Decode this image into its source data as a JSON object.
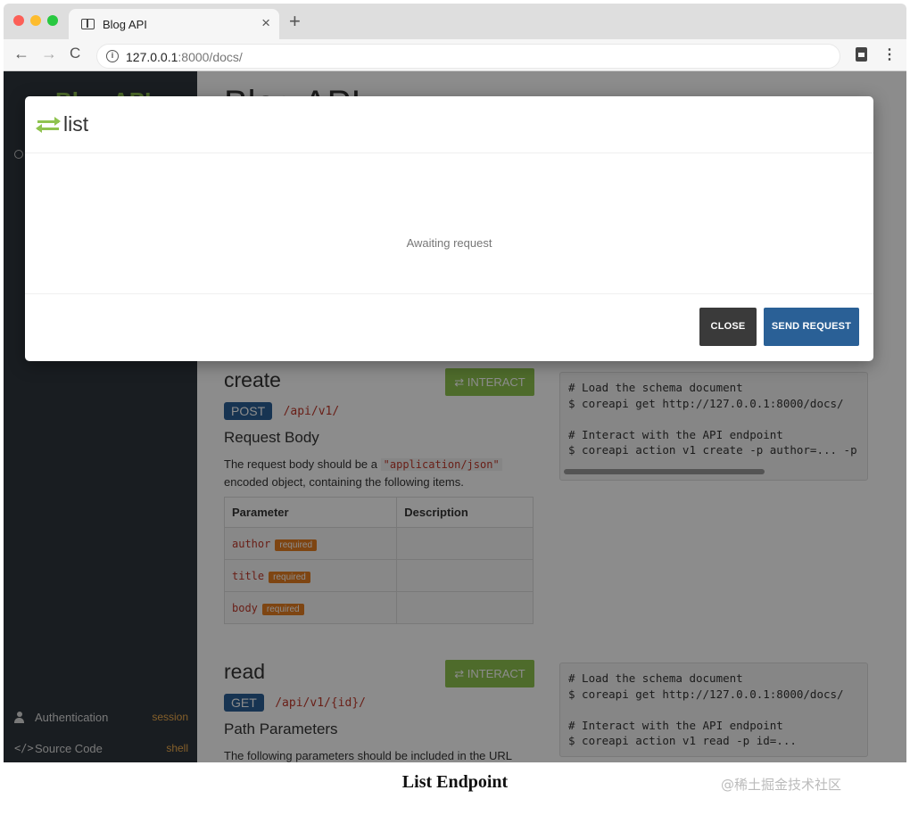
{
  "browser": {
    "tab_title": "Blog API",
    "tab_close": "×",
    "new_tab": "+",
    "url_host": "127.0.0.1",
    "url_rest": ":8000/docs/",
    "nav_back": "←",
    "nav_forward": "→",
    "nav_reload": "C",
    "menu": "⋮"
  },
  "sidebar": {
    "brand": "Blog API",
    "items": [
      {
        "label": "Authentication",
        "value": "session",
        "icon": "person-icon"
      },
      {
        "label": "Source Code",
        "value": "shell",
        "icon": "code-icon"
      }
    ]
  },
  "main": {
    "title": "Blog API",
    "create": {
      "title": "create",
      "interact_label": "⇄ INTERACT",
      "method": "POST",
      "path": "/api/v1/",
      "subheading": "Request Body",
      "description_pre": "The request body should be a",
      "description_code": "\"application/json\"",
      "description_post": "encoded object, containing the following items.",
      "table_headers": [
        "Parameter",
        "Description"
      ],
      "params": [
        {
          "name": "author",
          "badge": "required"
        },
        {
          "name": "title",
          "badge": "required"
        },
        {
          "name": "body",
          "badge": "required"
        }
      ],
      "code": "# Load the schema document\n$ coreapi get http://127.0.0.1:8000/docs/\n\n# Interact with the API endpoint\n$ coreapi action v1 create -p author=... -p"
    },
    "read": {
      "title": "read",
      "interact_label": "⇄ INTERACT",
      "method": "GET",
      "path": "/api/v1/{id}/",
      "subheading": "Path Parameters",
      "description": "The following parameters should be included in the URL",
      "code": "# Load the schema document\n$ coreapi get http://127.0.0.1:8000/docs/\n\n# Interact with the API endpoint\n$ coreapi action v1 read -p id=..."
    }
  },
  "modal": {
    "title": "list",
    "status": "Awaiting request",
    "close_label": "CLOSE",
    "send_label": "SEND REQUEST"
  },
  "caption": "List Endpoint",
  "watermark": "@稀土掘金技术社区",
  "colors": {
    "accent_green": "#8fc34f",
    "method_blue": "#2a6096",
    "badge_orange": "#e67e22",
    "sidebar_bg": "#2e353d"
  }
}
